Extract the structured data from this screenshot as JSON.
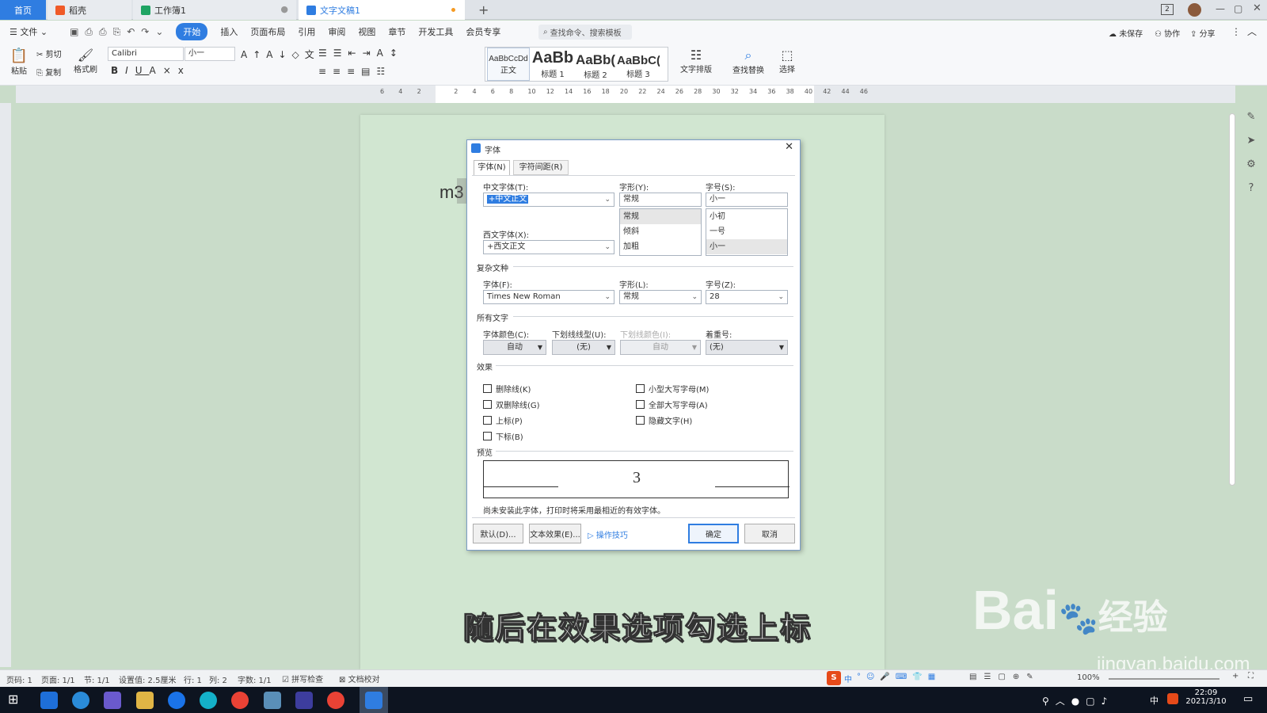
{
  "tabs": {
    "home": "首页",
    "daoke": "稻壳",
    "sheet": "工作簿1",
    "doc": "文字文稿1",
    "new_tab": "+"
  },
  "menu": {
    "file": "文件",
    "items": [
      "开始",
      "插入",
      "页面布局",
      "引用",
      "审阅",
      "视图",
      "章节",
      "开发工具",
      "会员专享"
    ],
    "search_placeholder": "查找命令、搜索模板",
    "unsaved": "未保存",
    "collab": "协作",
    "share": "分享"
  },
  "ribbon": {
    "paste": "粘贴",
    "cut": "剪切",
    "copy": "复制",
    "format_painter": "格式刷",
    "font_name": "Calibri",
    "font_size": "小一",
    "styles": [
      {
        "preview": "AaBbCcDd",
        "label": "正文"
      },
      {
        "preview": "AaBb",
        "label": "标题 1"
      },
      {
        "preview": "AaBb(",
        "label": "标题 2"
      },
      {
        "preview": "AaBbC(",
        "label": "标题 3"
      }
    ],
    "text_layout": "文字排版",
    "find_replace": "查找替换",
    "select": "选择"
  },
  "ruler": {
    "ticks": [
      "6",
      "4",
      "2",
      "",
      "2",
      "4",
      "6",
      "8",
      "10",
      "12",
      "14",
      "16",
      "18",
      "20",
      "22",
      "24",
      "26",
      "28",
      "30",
      "32",
      "34",
      "36",
      "38",
      "40",
      "42",
      "44",
      "46"
    ]
  },
  "document": {
    "text": "m3"
  },
  "dialog": {
    "title": "字体",
    "tab_font": "字体(N)",
    "tab_spacing": "字符间距(R)",
    "cn_font_label": "中文字体(T):",
    "cn_font_value": "+中文正文",
    "style_label": "字形(Y):",
    "style_value": "常规",
    "style_list": [
      "常规",
      "倾斜",
      "加粗"
    ],
    "size_label": "字号(S):",
    "size_value": "小一",
    "size_list": [
      "小初",
      "一号",
      "小一"
    ],
    "west_font_label": "西文字体(X):",
    "west_font_value": "+西文正文",
    "complex_section": "复杂文种",
    "complex_font_label": "字体(F):",
    "complex_font_value": "Times New Roman",
    "complex_style_label": "字形(L):",
    "complex_style_value": "常规",
    "complex_size_label": "字号(Z):",
    "complex_size_value": "28",
    "all_text_section": "所有文字",
    "color_label": "字体颜色(C):",
    "color_value": "自动",
    "underline_label": "下划线线型(U):",
    "underline_value": "(无)",
    "underline_color_label": "下划线颜色(I):",
    "underline_color_value": "自动",
    "emphasis_label": "着重号:",
    "emphasis_value": "(无)",
    "effects_section": "效果",
    "strike": "删除线(K)",
    "double_strike": "双删除线(G)",
    "superscript": "上标(P)",
    "subscript": "下标(B)",
    "small_caps": "小型大写字母(M)",
    "all_caps": "全部大写字母(A)",
    "hidden": "隐藏文字(H)",
    "preview_section": "预览",
    "preview_text": "3",
    "note": "尚未安装此字体，打印时将采用最相近的有效字体。",
    "default_btn": "默认(D)...",
    "text_effect_btn": "文本效果(E)...",
    "tips": "操作技巧",
    "ok": "确定",
    "cancel": "取消"
  },
  "status": {
    "page": "页码: 1",
    "pages": "页面: 1/1",
    "section": "节: 1/1",
    "setting": "设置值: 2.5厘米",
    "row": "行: 1",
    "col": "列: 2",
    "words": "字数: 1/1",
    "spell": "拼写检查",
    "proof": "文档校对",
    "zoom": "100%"
  },
  "ime": {
    "mode": "中"
  },
  "taskbar": {
    "time": "22:09",
    "date": "2021/3/10",
    "lang": "中"
  },
  "caption": "随后在效果选项勾选上标",
  "watermark": {
    "brand": "Bai",
    "brand2": "经验",
    "url": "jingyan.baidu.com"
  },
  "colors": {
    "accent": "#2f7de1",
    "page_bg": "#c9dcc9"
  }
}
